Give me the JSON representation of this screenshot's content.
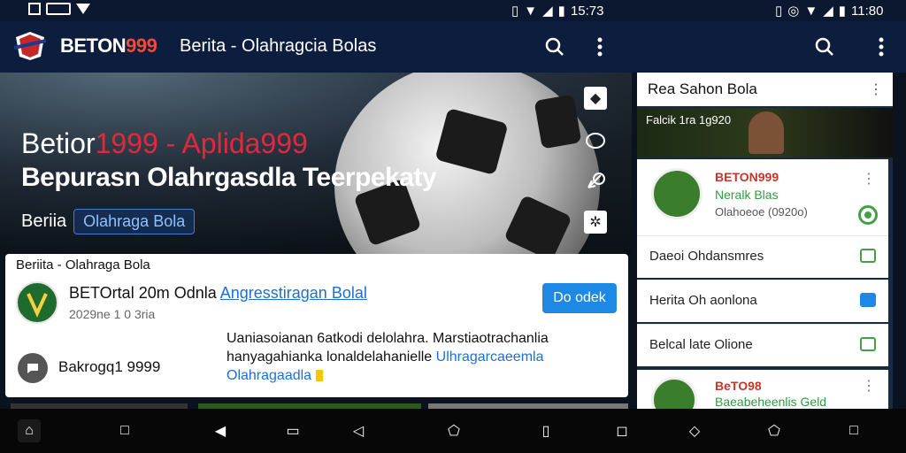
{
  "status_bar": {
    "left_icons": [
      "image-icon",
      "sim-icon",
      "wifi-icon"
    ],
    "mid_time": "15:73",
    "right_time": "11:80"
  },
  "app_bar": {
    "brand_white": "BETON",
    "brand_red": "999",
    "title": "Berita - Olahragcia Bolas"
  },
  "hero": {
    "line1_white": "Betior",
    "line1_red": "1999 - Aplida999",
    "line2": "Bepurasn Olahrgasdla Teerpekaty",
    "label": "Beriia",
    "chip": "Olahraga Bola"
  },
  "card": {
    "label": "Beriita - Olahraga Bola",
    "line1_main": "BETOrtal 20m Odnla ",
    "line1_link": "Angresstiragan Bolal",
    "line2": "2029ne 1 0 3ria",
    "button": "Do odek",
    "round_text": "Bakrogq1 9999",
    "para_line1": "Uaniasoianan 6atkodi delolahra.  Marstiaotrachanlia",
    "para_line2_a": "hanyagahianka lonaldelahanielle ",
    "para_line2_b": "Ulhragarcaeemla",
    "para_line3": "Olahragaadla"
  },
  "right_panel": {
    "header": "Rea Sahon Bola",
    "banner_text": "Falcik 1ra 1g920",
    "card1": {
      "name": "BETON999",
      "sub": "Neralk Blas",
      "time": "Olahoeoe (0920o)"
    },
    "rows": [
      "Daeoi Ohdansmres",
      "Herita Oh aonlona",
      "Belcal late Olione"
    ],
    "card2": {
      "name": "BeTO98",
      "sub": "Baeabeheenlis Geld"
    }
  },
  "colors": {
    "accent_red": "#e3283a",
    "accent_blue": "#1e88e5",
    "app_bar": "#0d1d3d"
  }
}
